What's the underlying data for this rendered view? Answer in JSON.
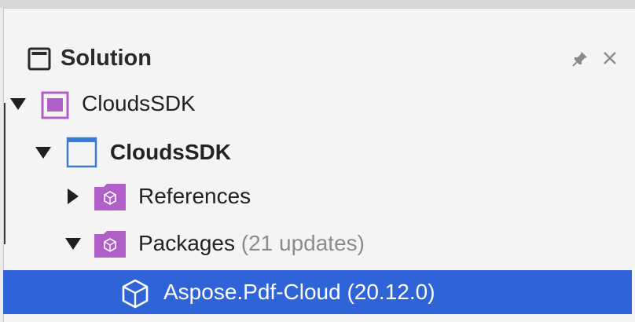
{
  "panel": {
    "title": "Solution",
    "icons": {
      "header": "solution-panel-icon",
      "pin": "pin-icon",
      "close": "close-icon"
    }
  },
  "tree": {
    "items": [
      {
        "label": "CloudsSDK",
        "icon": "solution-icon",
        "expanded": true
      },
      {
        "label": "CloudsSDK",
        "icon": "project-icon",
        "expanded": true
      },
      {
        "label": "References",
        "icon": "folder-package-icon",
        "expanded": false
      },
      {
        "label": "Packages",
        "suffix": "(21 updates)",
        "icon": "folder-package-icon",
        "expanded": true
      },
      {
        "label": "Aspose.Pdf-Cloud (20.12.0)",
        "icon": "package-cube-icon",
        "selected": true
      }
    ]
  },
  "colors": {
    "selection": "#2f63d8",
    "purple": "#b05ec8",
    "blue": "#3b7ad0"
  }
}
